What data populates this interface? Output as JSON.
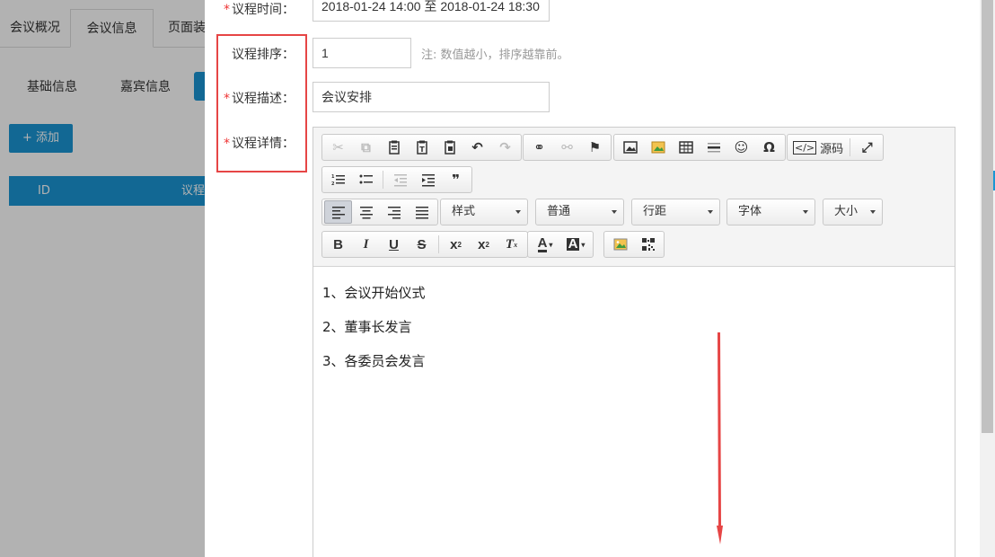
{
  "background": {
    "tabs": [
      "会议概况",
      "会议信息",
      "页面装"
    ],
    "subtabs": [
      "基础信息",
      "嘉宾信息"
    ],
    "add_button": "+ 添加",
    "table_headers": [
      "ID",
      "议程"
    ]
  },
  "form": {
    "time_label": "议程时间：",
    "time_value": "2018-01-24 14:00 至 2018-01-24 18:30",
    "order_label": "议程排序：",
    "order_value": "1",
    "order_hint": "注: 数值越小，排序越靠前。",
    "desc_label": "议程描述：",
    "desc_value": "会议安排",
    "detail_label": "议程详情："
  },
  "editor": {
    "source_label": "源码",
    "selects": [
      "样式",
      "普通",
      "行距",
      "字体",
      "大小"
    ],
    "content": [
      "1、会议开始仪式",
      "2、董事长发言",
      "3、各委员会发言"
    ]
  },
  "colors": {
    "accent": "#1a96d4",
    "highlight_box": "#e64545",
    "required_star": "#e33"
  }
}
